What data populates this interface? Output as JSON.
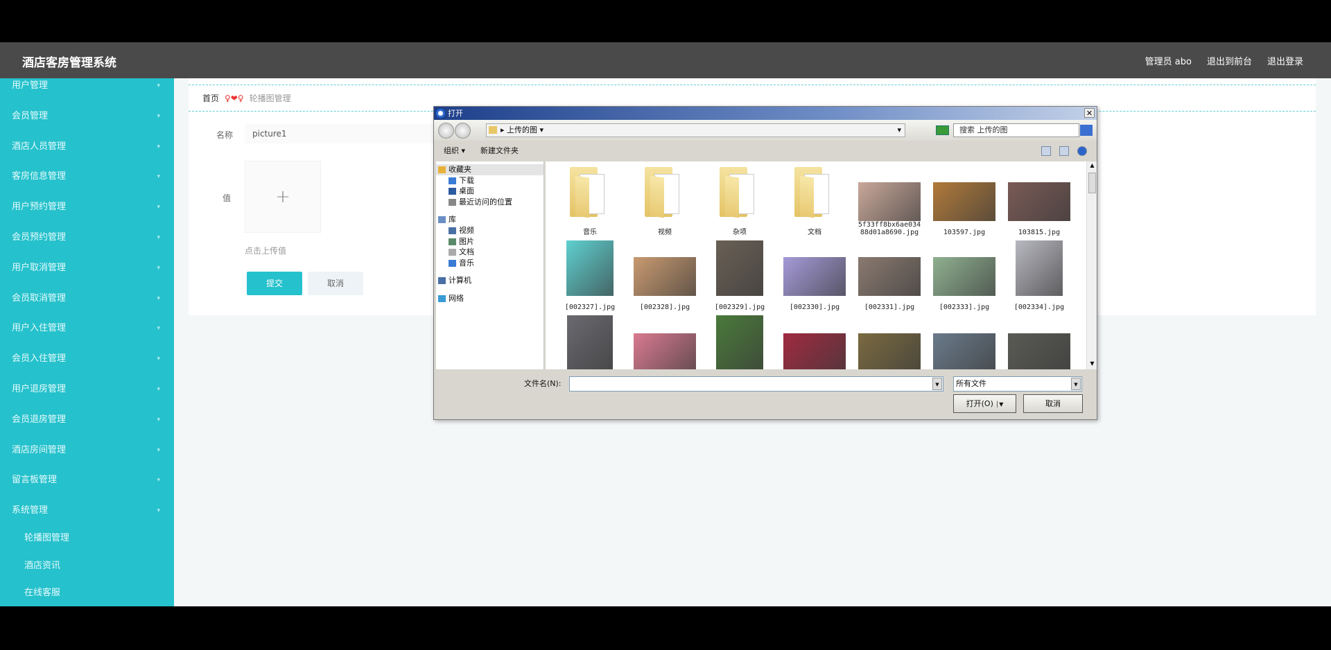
{
  "header": {
    "title": "酒店客房管理系统",
    "user": "管理员 abo",
    "to_front": "退出到前台",
    "logout": "退出登录"
  },
  "sidebar": {
    "items": [
      "用户管理",
      "会员管理",
      "酒店人员管理",
      "客房信息管理",
      "用户预约管理",
      "会员预约管理",
      "用户取消管理",
      "会员取消管理",
      "用户入住管理",
      "会员入住管理",
      "用户退房管理",
      "会员退房管理",
      "酒店房间管理",
      "留言板管理",
      "系统管理"
    ],
    "subitems": [
      "轮播图管理",
      "酒店资讯",
      "在线客服"
    ]
  },
  "breadcrumb": {
    "home": "首页",
    "current": "轮播图管理"
  },
  "form": {
    "name_label": "名称",
    "name_value": "picture1",
    "value_label": "值",
    "upload_hint": "点击上传值",
    "submit": "提交",
    "cancel": "取消"
  },
  "dialog": {
    "title": "打开",
    "path": "上传的图",
    "search_placeholder": "搜索 上传的图",
    "organize": "组织",
    "new_folder": "新建文件夹",
    "tree": [
      {
        "label": "收藏夹",
        "level": 0,
        "selected": true,
        "color": "#e8b13a"
      },
      {
        "label": "下载",
        "level": 1,
        "color": "#3a7bd5"
      },
      {
        "label": "桌面",
        "level": 1,
        "color": "#2c5aa0"
      },
      {
        "label": "最近访问的位置",
        "level": 1,
        "color": "#888888"
      },
      {
        "gap": true
      },
      {
        "label": "库",
        "level": 0,
        "color": "#6b8fc4"
      },
      {
        "label": "视频",
        "level": 1,
        "color": "#4a6fa5"
      },
      {
        "label": "图片",
        "level": 1,
        "color": "#5a8a6a"
      },
      {
        "label": "文档",
        "level": 1,
        "color": "#aaaaaa"
      },
      {
        "label": "音乐",
        "level": 1,
        "color": "#3a7bd5"
      },
      {
        "gap": true
      },
      {
        "label": "计算机",
        "level": 0,
        "color": "#4a6fa5"
      },
      {
        "gap": true
      },
      {
        "label": "网络",
        "level": 0,
        "color": "#3a9ad5"
      }
    ],
    "files": [
      {
        "name": "音乐",
        "type": "folder"
      },
      {
        "name": "视频",
        "type": "folder"
      },
      {
        "name": "杂项",
        "type": "folder"
      },
      {
        "name": "文档",
        "type": "folder"
      },
      {
        "name": "5f33ff8bx6ae034 88d01a8690.jpg",
        "type": "image",
        "color": "#c9a89a"
      },
      {
        "name": "103597.jpg",
        "type": "image",
        "color": "#b07a3a"
      },
      {
        "name": "103815.jpg",
        "type": "image",
        "color": "#7a5a55"
      },
      {
        "name": "[002327].jpg",
        "type": "image",
        "color": "#5fd0d0",
        "tall": true
      },
      {
        "name": "[002328].jpg",
        "type": "image",
        "color": "#c99a70"
      },
      {
        "name": "[002329].jpg",
        "type": "image",
        "color": "#6a6055",
        "tall": true
      },
      {
        "name": "[002330].jpg",
        "type": "image",
        "color": "#a59ad8"
      },
      {
        "name": "[002331].jpg",
        "type": "image",
        "color": "#8a7a70"
      },
      {
        "name": "[002333].jpg",
        "type": "image",
        "color": "#8fb090"
      },
      {
        "name": "[002334].jpg",
        "type": "image",
        "color": "#b8b8c0",
        "tall": true
      },
      {
        "type": "image",
        "color": "#6a6a70",
        "tall": true
      },
      {
        "type": "image",
        "color": "#d97a90"
      },
      {
        "type": "image",
        "color": "#4a7a3a",
        "tall": true
      },
      {
        "type": "image",
        "color": "#a02a40"
      },
      {
        "type": "image",
        "color": "#7a6a40"
      },
      {
        "type": "image",
        "color": "#6a7a8a"
      },
      {
        "type": "image",
        "color": "#5a5a55"
      }
    ],
    "filename_label": "文件名(N):",
    "filename_value": "",
    "filetype": "所有文件",
    "open": "打开(O)",
    "cancel": "取消"
  }
}
